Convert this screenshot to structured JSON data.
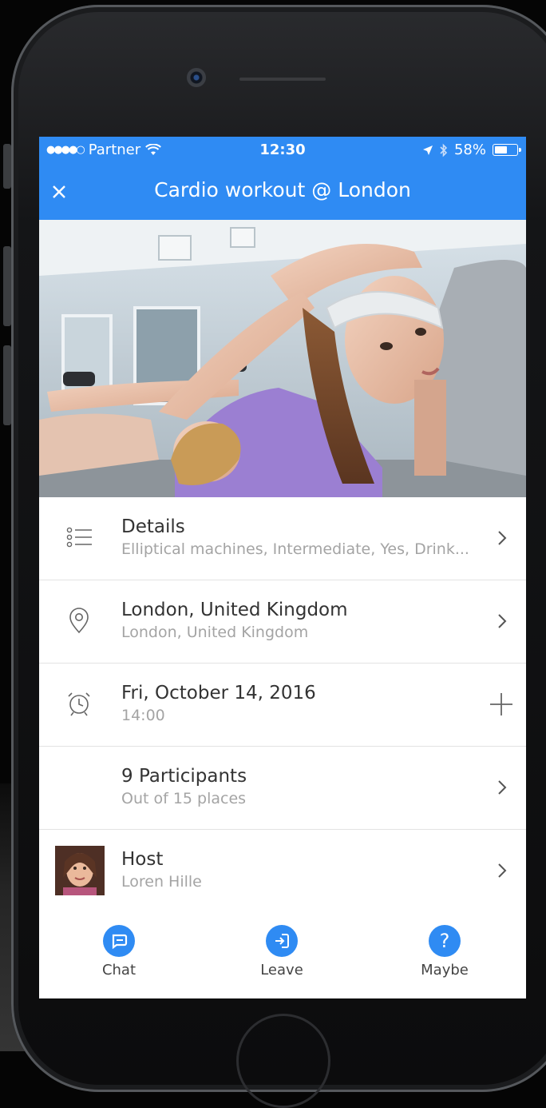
{
  "status_bar": {
    "carrier": "Partner",
    "time": "12:30",
    "battery": "58%",
    "battery_level": 0.58
  },
  "header": {
    "title": "Cardio workout @ London",
    "close_icon": "close-icon"
  },
  "rows": [
    {
      "icon": "list-icon",
      "title": "Details",
      "subtitle": "Elliptical machines, Intermediate, Yes, Drink...",
      "action": "chevron-right-icon"
    },
    {
      "icon": "location-pin-icon",
      "title": "London, United Kingdom",
      "subtitle": "London, United Kingdom",
      "action": "chevron-right-icon"
    },
    {
      "icon": "alarm-clock-icon",
      "title": "Fri, October 14, 2016",
      "subtitle": "14:00",
      "action": "plus-icon"
    },
    {
      "icon": "",
      "title": "9 Participants",
      "subtitle": "Out of 15 places",
      "action": "chevron-right-icon"
    },
    {
      "icon": "avatar",
      "title": "Host",
      "subtitle": "Loren Hille",
      "action": "chevron-right-icon"
    }
  ],
  "tabs": [
    {
      "icon": "chat-icon",
      "label": "Chat"
    },
    {
      "icon": "leave-icon",
      "label": "Leave"
    },
    {
      "icon": "question-icon",
      "label": "Maybe"
    }
  ],
  "colors": {
    "accent": "#2f8bf3",
    "text_primary": "#333333",
    "text_secondary": "#a4a4a4"
  }
}
